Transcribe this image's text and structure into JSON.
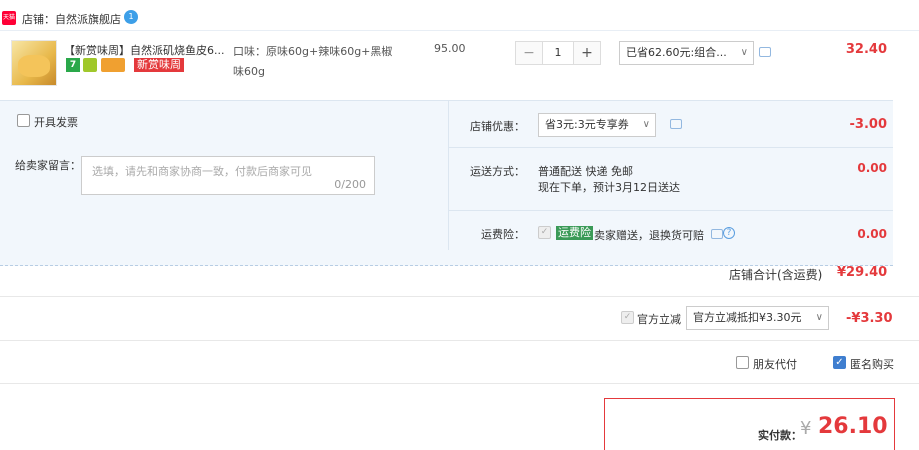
{
  "store": {
    "tmall_logo": "天猫",
    "label": "店铺：自然派旗舰店",
    "badge": "1"
  },
  "item": {
    "title": "【新赏味周】自然派矶烧鱼皮6...",
    "tag_7": "7",
    "tag_new": "新赏味周",
    "spec": "口味：原味60g+辣味60g+黑椒味60g",
    "price": "95.00",
    "qty_minus": "−",
    "qty": "1",
    "qty_plus": "+",
    "promo": "已省62.60元:组合...",
    "subtotal": "32.40"
  },
  "invoice": {
    "label": "开具发票"
  },
  "message": {
    "label": "给卖家留言：",
    "placeholder": "选填，请先和商家协商一致，付款后商家可见",
    "count": "0/200"
  },
  "discount": {
    "label": "店铺优惠：",
    "select": "省3元:3元专享券",
    "amount": "-3.00"
  },
  "shipping": {
    "label": "运送方式：",
    "method": "普通配送 快递 免邮",
    "eta": "现在下单，预计3月12日送达",
    "amount": "0.00"
  },
  "insurance": {
    "label": "运费险：",
    "tag": "运费险",
    "desc": "卖家赠送，退换货可赔",
    "amount": "0.00"
  },
  "store_total": {
    "label": "店铺合计(含运费)",
    "amount": "¥29.40"
  },
  "official": {
    "label": "官方立减",
    "select": "官方立减抵扣¥3.30元",
    "amount": "-¥3.30"
  },
  "options": {
    "friend_pay": "朋友代付",
    "anonymous": "匿名购买"
  },
  "payment": {
    "label": "实付款：",
    "currency": "¥",
    "amount": "26.10"
  },
  "colors": {
    "accent": "#e4393c",
    "panel": "#f2f7fc",
    "link": "#3f7ecf"
  }
}
